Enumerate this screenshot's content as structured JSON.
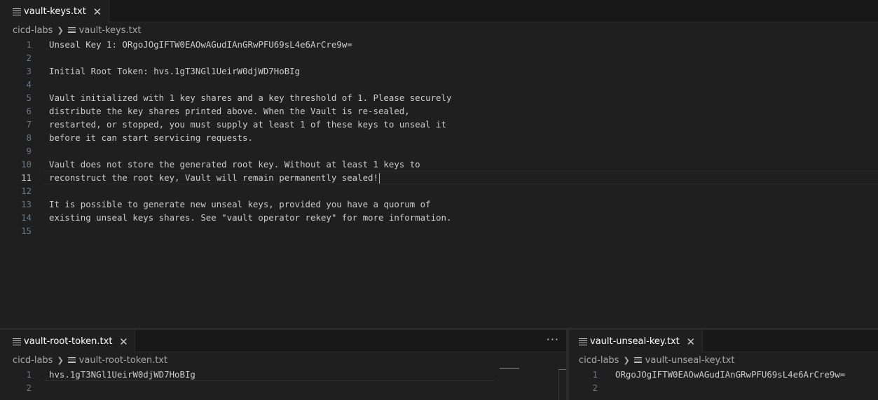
{
  "top_group": {
    "tab": {
      "label": "vault-keys.txt"
    },
    "breadcrumb": {
      "folder": "cicd-labs",
      "file": "vault-keys.txt"
    },
    "lines": [
      {
        "n": "1",
        "text": "Unseal Key 1: ORgoJOgIFTW0EAOwAGudIAnGRwPFU69sL4e6ArCre9w="
      },
      {
        "n": "2",
        "text": ""
      },
      {
        "n": "3",
        "text": "Initial Root Token: hvs.1gT3NGl1UeirW0djWD7HoBIg"
      },
      {
        "n": "4",
        "text": ""
      },
      {
        "n": "5",
        "text": "Vault initialized with 1 key shares and a key threshold of 1. Please securely"
      },
      {
        "n": "6",
        "text": "distribute the key shares printed above. When the Vault is re-sealed,"
      },
      {
        "n": "7",
        "text": "restarted, or stopped, you must supply at least 1 of these keys to unseal it"
      },
      {
        "n": "8",
        "text": "before it can start servicing requests."
      },
      {
        "n": "9",
        "text": ""
      },
      {
        "n": "10",
        "text": "Vault does not store the generated root key. Without at least 1 keys to"
      },
      {
        "n": "11",
        "text": "reconstruct the root key, Vault will remain permanently sealed!"
      },
      {
        "n": "12",
        "text": ""
      },
      {
        "n": "13",
        "text": "It is possible to generate new unseal keys, provided you have a quorum of"
      },
      {
        "n": "14",
        "text": "existing unseal keys shares. See \"vault operator rekey\" for more information."
      },
      {
        "n": "15",
        "text": ""
      }
    ],
    "current_line": "11"
  },
  "bottom_left_group": {
    "tab": {
      "label": "vault-root-token.txt"
    },
    "more_actions": "···",
    "breadcrumb": {
      "folder": "cicd-labs",
      "file": "vault-root-token.txt"
    },
    "lines": [
      {
        "n": "1",
        "text": "hvs.1gT3NGl1UeirW0djWD7HoBIg"
      },
      {
        "n": "2",
        "text": ""
      }
    ]
  },
  "bottom_right_group": {
    "tab": {
      "label": "vault-unseal-key.txt"
    },
    "breadcrumb": {
      "folder": "cicd-labs",
      "file": "vault-unseal-key.txt"
    },
    "lines": [
      {
        "n": "1",
        "text": "ORgoJOgIFTW0EAOwAGudIAnGRwPFU69sL4e6ArCre9w="
      },
      {
        "n": "2",
        "text": ""
      }
    ]
  },
  "icons": {
    "file": "file-text-icon",
    "close": "close-icon",
    "chevron": "chevron-right-icon",
    "more": "more-actions-icon"
  },
  "colors": {
    "editor_bg": "#1f1f1f",
    "tabbar_bg": "#181818",
    "text": "#cccccc",
    "line_number": "#6e7681"
  }
}
